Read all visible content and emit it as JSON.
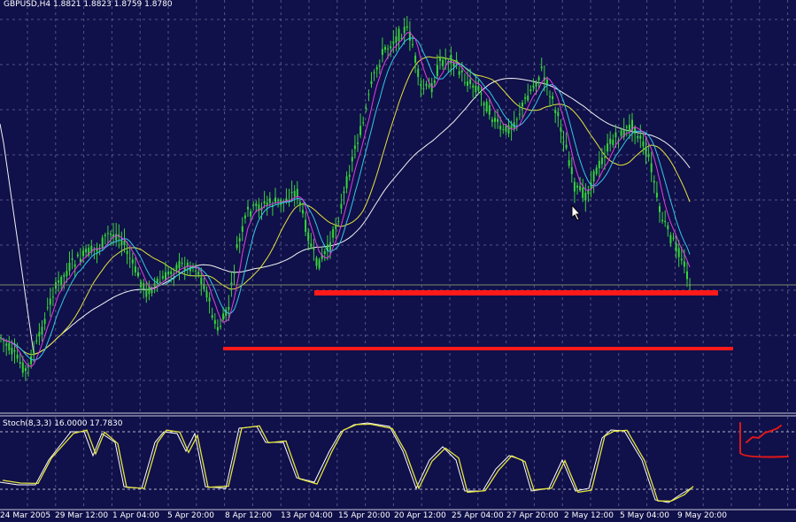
{
  "main_header": {
    "symbol": "GBPUSD,H4",
    "open": "1.8821",
    "high": "1.8823",
    "low": "1.8759",
    "close": "1.8780"
  },
  "stoch_header": {
    "name": "Stoch(8,3,3)",
    "main": "16.0000",
    "signal": "17.7830"
  },
  "x_axis_labels": [
    "24 Mar 2005",
    "29 Mar 12:00",
    "1 Apr 04:00",
    "5 Apr 20:00",
    "8 Apr 12:00",
    "13 Apr 04:00",
    "15 Apr 20:00",
    "20 Apr 12:00",
    "25 Apr 04:00",
    "27 Apr 20:00",
    "2 May 12:00",
    "5 May 04:00",
    "9 May 20:00"
  ],
  "colors": {
    "background": "#10104a",
    "grid": "#8c8cb4",
    "candles": "#39d33b",
    "ma_fast": "#e040e0",
    "ma_cyan": "#35c8e8",
    "ma_yellow": "#e4e43c",
    "ma_white": "#f2f2f2",
    "support_line": "#ff1a1a",
    "stoch_main": "#e4e43c",
    "stoch_signal": "#ffffff",
    "annotation": "#e01818"
  },
  "icons": {
    "cursor": "mouse-pointer-icon",
    "annotation": "hand-drawn-rising-line-icon"
  }
}
